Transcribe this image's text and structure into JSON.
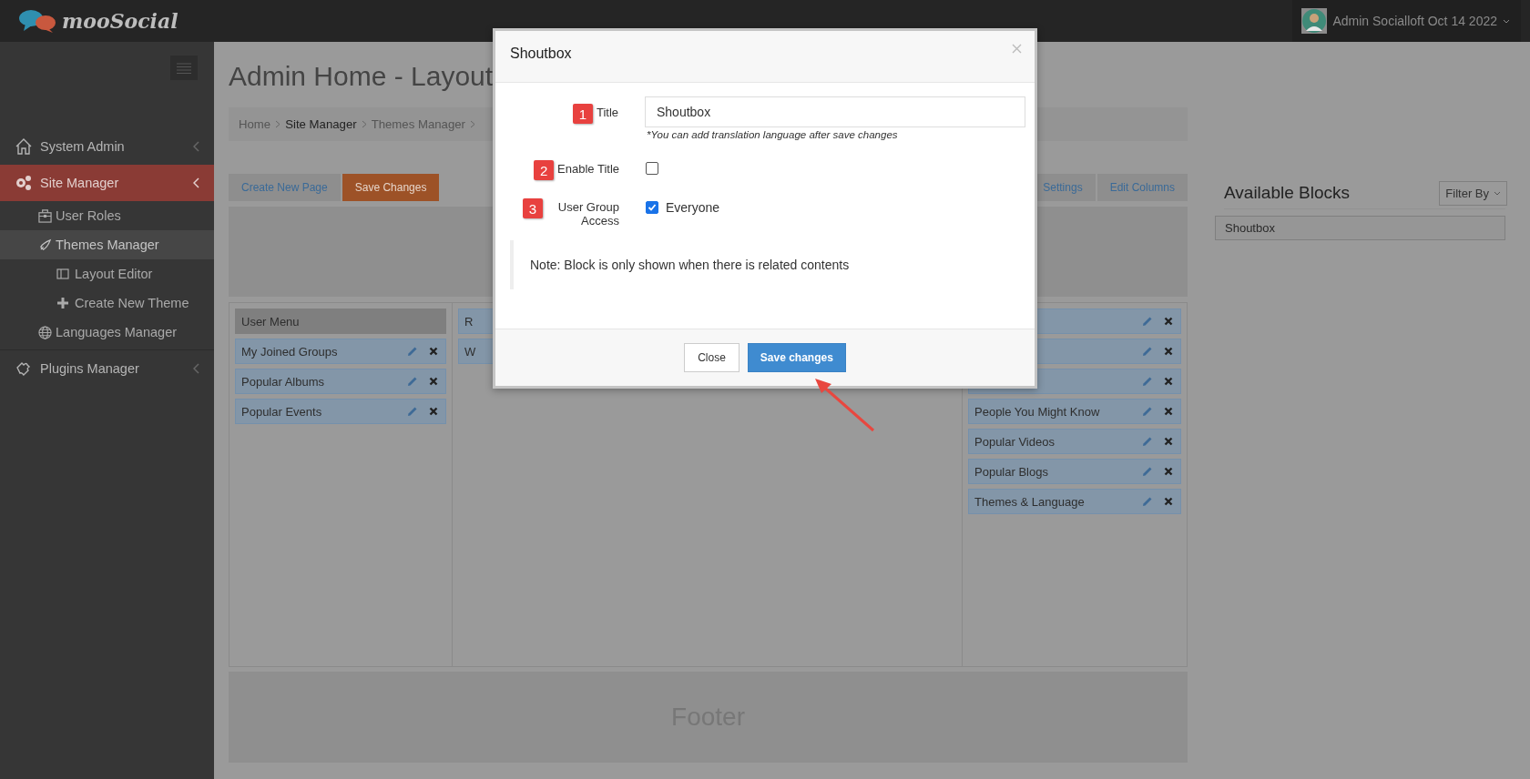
{
  "header": {
    "logo": "mooSocial",
    "user": "Admin Socialloft Oct 14 2022"
  },
  "sidebar": {
    "items": [
      {
        "label": "System Admin",
        "selected": false
      },
      {
        "label": "Site Manager",
        "selected": true,
        "children": [
          {
            "label": "User Roles",
            "selected": false
          },
          {
            "label": "Themes Manager",
            "selected": true,
            "children": [
              {
                "label": "Layout Editor",
                "selected": false
              },
              {
                "label": "Create New Theme",
                "selected": false
              }
            ]
          },
          {
            "label": "Languages Manager",
            "selected": false
          }
        ]
      },
      {
        "label": "Plugins Manager",
        "selected": false
      }
    ]
  },
  "page": {
    "title": "Admin Home - Layout",
    "breadcrumb": [
      {
        "label": "Home",
        "active": false
      },
      {
        "label": "Site Manager",
        "active": true
      },
      {
        "label": "Themes Manager",
        "active": false
      }
    ],
    "toolbar_left": [
      {
        "label": "Create New Page",
        "kind": "default"
      },
      {
        "label": "Save Changes",
        "kind": "primary"
      }
    ],
    "toolbar_right": [
      {
        "label": "Settings"
      },
      {
        "label": "Edit Columns"
      }
    ],
    "columns": [
      {
        "items": [
          {
            "label": "User Menu",
            "kind": "menu"
          },
          {
            "label": "My Joined Groups",
            "kind": "block"
          },
          {
            "label": "Popular Albums",
            "kind": "block"
          },
          {
            "label": "Popular Events",
            "kind": "block"
          }
        ]
      },
      {
        "items": [
          {
            "label": "R",
            "kind": "partial"
          },
          {
            "label": "W",
            "kind": "partial"
          }
        ]
      },
      {
        "items": [
          {
            "kind": "block"
          },
          {
            "kind": "block"
          },
          {
            "kind": "block"
          },
          {
            "label": "People You Might Know",
            "kind": "block"
          },
          {
            "label": "Popular Videos",
            "kind": "block"
          },
          {
            "label": "Popular Blogs",
            "kind": "block"
          },
          {
            "label": "Themes & Language",
            "kind": "block"
          }
        ]
      }
    ],
    "footer": "Footer"
  },
  "available": {
    "title": "Available Blocks",
    "filter": "Filter By",
    "items": [
      "Shoutbox"
    ]
  },
  "modal": {
    "title": "Shoutbox",
    "fields": [
      {
        "number": "1",
        "label": "Title",
        "kind": "text",
        "value": "Shoutbox",
        "hint": "*You can add translation language after save changes"
      },
      {
        "number": "2",
        "label": "Enable Title",
        "kind": "checkbox",
        "checked": false
      },
      {
        "number": "3",
        "label": "User Group Access",
        "kind": "checkbox",
        "checked": true,
        "option": "Everyone"
      }
    ],
    "note": "Note: Block is only shown when there is related contents",
    "buttons": [
      {
        "label": "Close",
        "kind": "default"
      },
      {
        "label": "Save changes",
        "kind": "primary"
      }
    ]
  }
}
